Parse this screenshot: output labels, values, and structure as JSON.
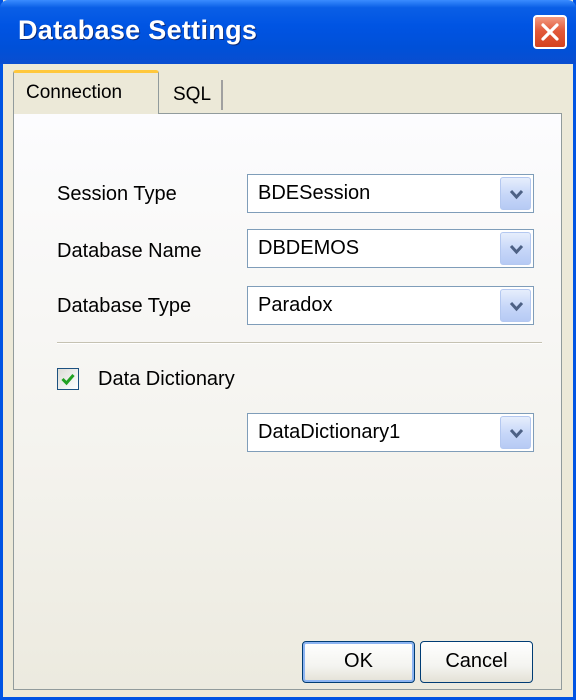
{
  "window": {
    "title": "Database Settings",
    "title_color": "#FFFFFF",
    "titlebar_color": "#0054E3"
  },
  "tabs": [
    {
      "label": "Connection",
      "active": true
    },
    {
      "label": "SQL",
      "active": false
    }
  ],
  "connection": {
    "session_type": {
      "label": "Session Type",
      "value": "BDESession"
    },
    "database_name": {
      "label": "Database Name",
      "value": "DBDEMOS"
    },
    "database_type": {
      "label": "Database Type",
      "value": "Paradox"
    },
    "data_dictionary": {
      "label": "Data Dictionary",
      "checked": true,
      "value": "DataDictionary1"
    }
  },
  "buttons": {
    "ok": "OK",
    "cancel": "Cancel"
  },
  "icons": {
    "close": "close-icon",
    "dropdown": "chevron-down-icon",
    "check": "checkmark-icon"
  },
  "colors": {
    "dialog_bg": "#ECE9D8",
    "active_tab_accent": "#FFC83C",
    "check_color": "#21A121",
    "close_button": "#E25A3B"
  }
}
